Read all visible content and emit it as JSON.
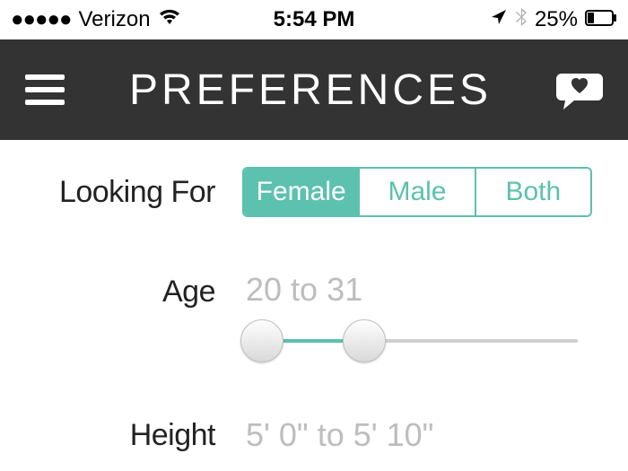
{
  "statusbar": {
    "signal_dots": "●●●●●",
    "carrier": "Verizon",
    "time": "5:54 PM",
    "battery_pct": "25%"
  },
  "header": {
    "title": "PREFERENCES"
  },
  "preferences": {
    "looking_for": {
      "label": "Looking For",
      "options": [
        "Female",
        "Male",
        "Both"
      ],
      "selected_index": 0
    },
    "age": {
      "label": "Age",
      "display": "20 to 31",
      "min": 20,
      "max": 31,
      "range_min": 18,
      "range_max": 60
    },
    "height": {
      "label": "Height",
      "display": "5' 0\" to 5' 10\""
    }
  },
  "colors": {
    "accent": "#5cc1ae",
    "navbar_bg": "#333333",
    "muted_text": "#bdbdbd"
  }
}
